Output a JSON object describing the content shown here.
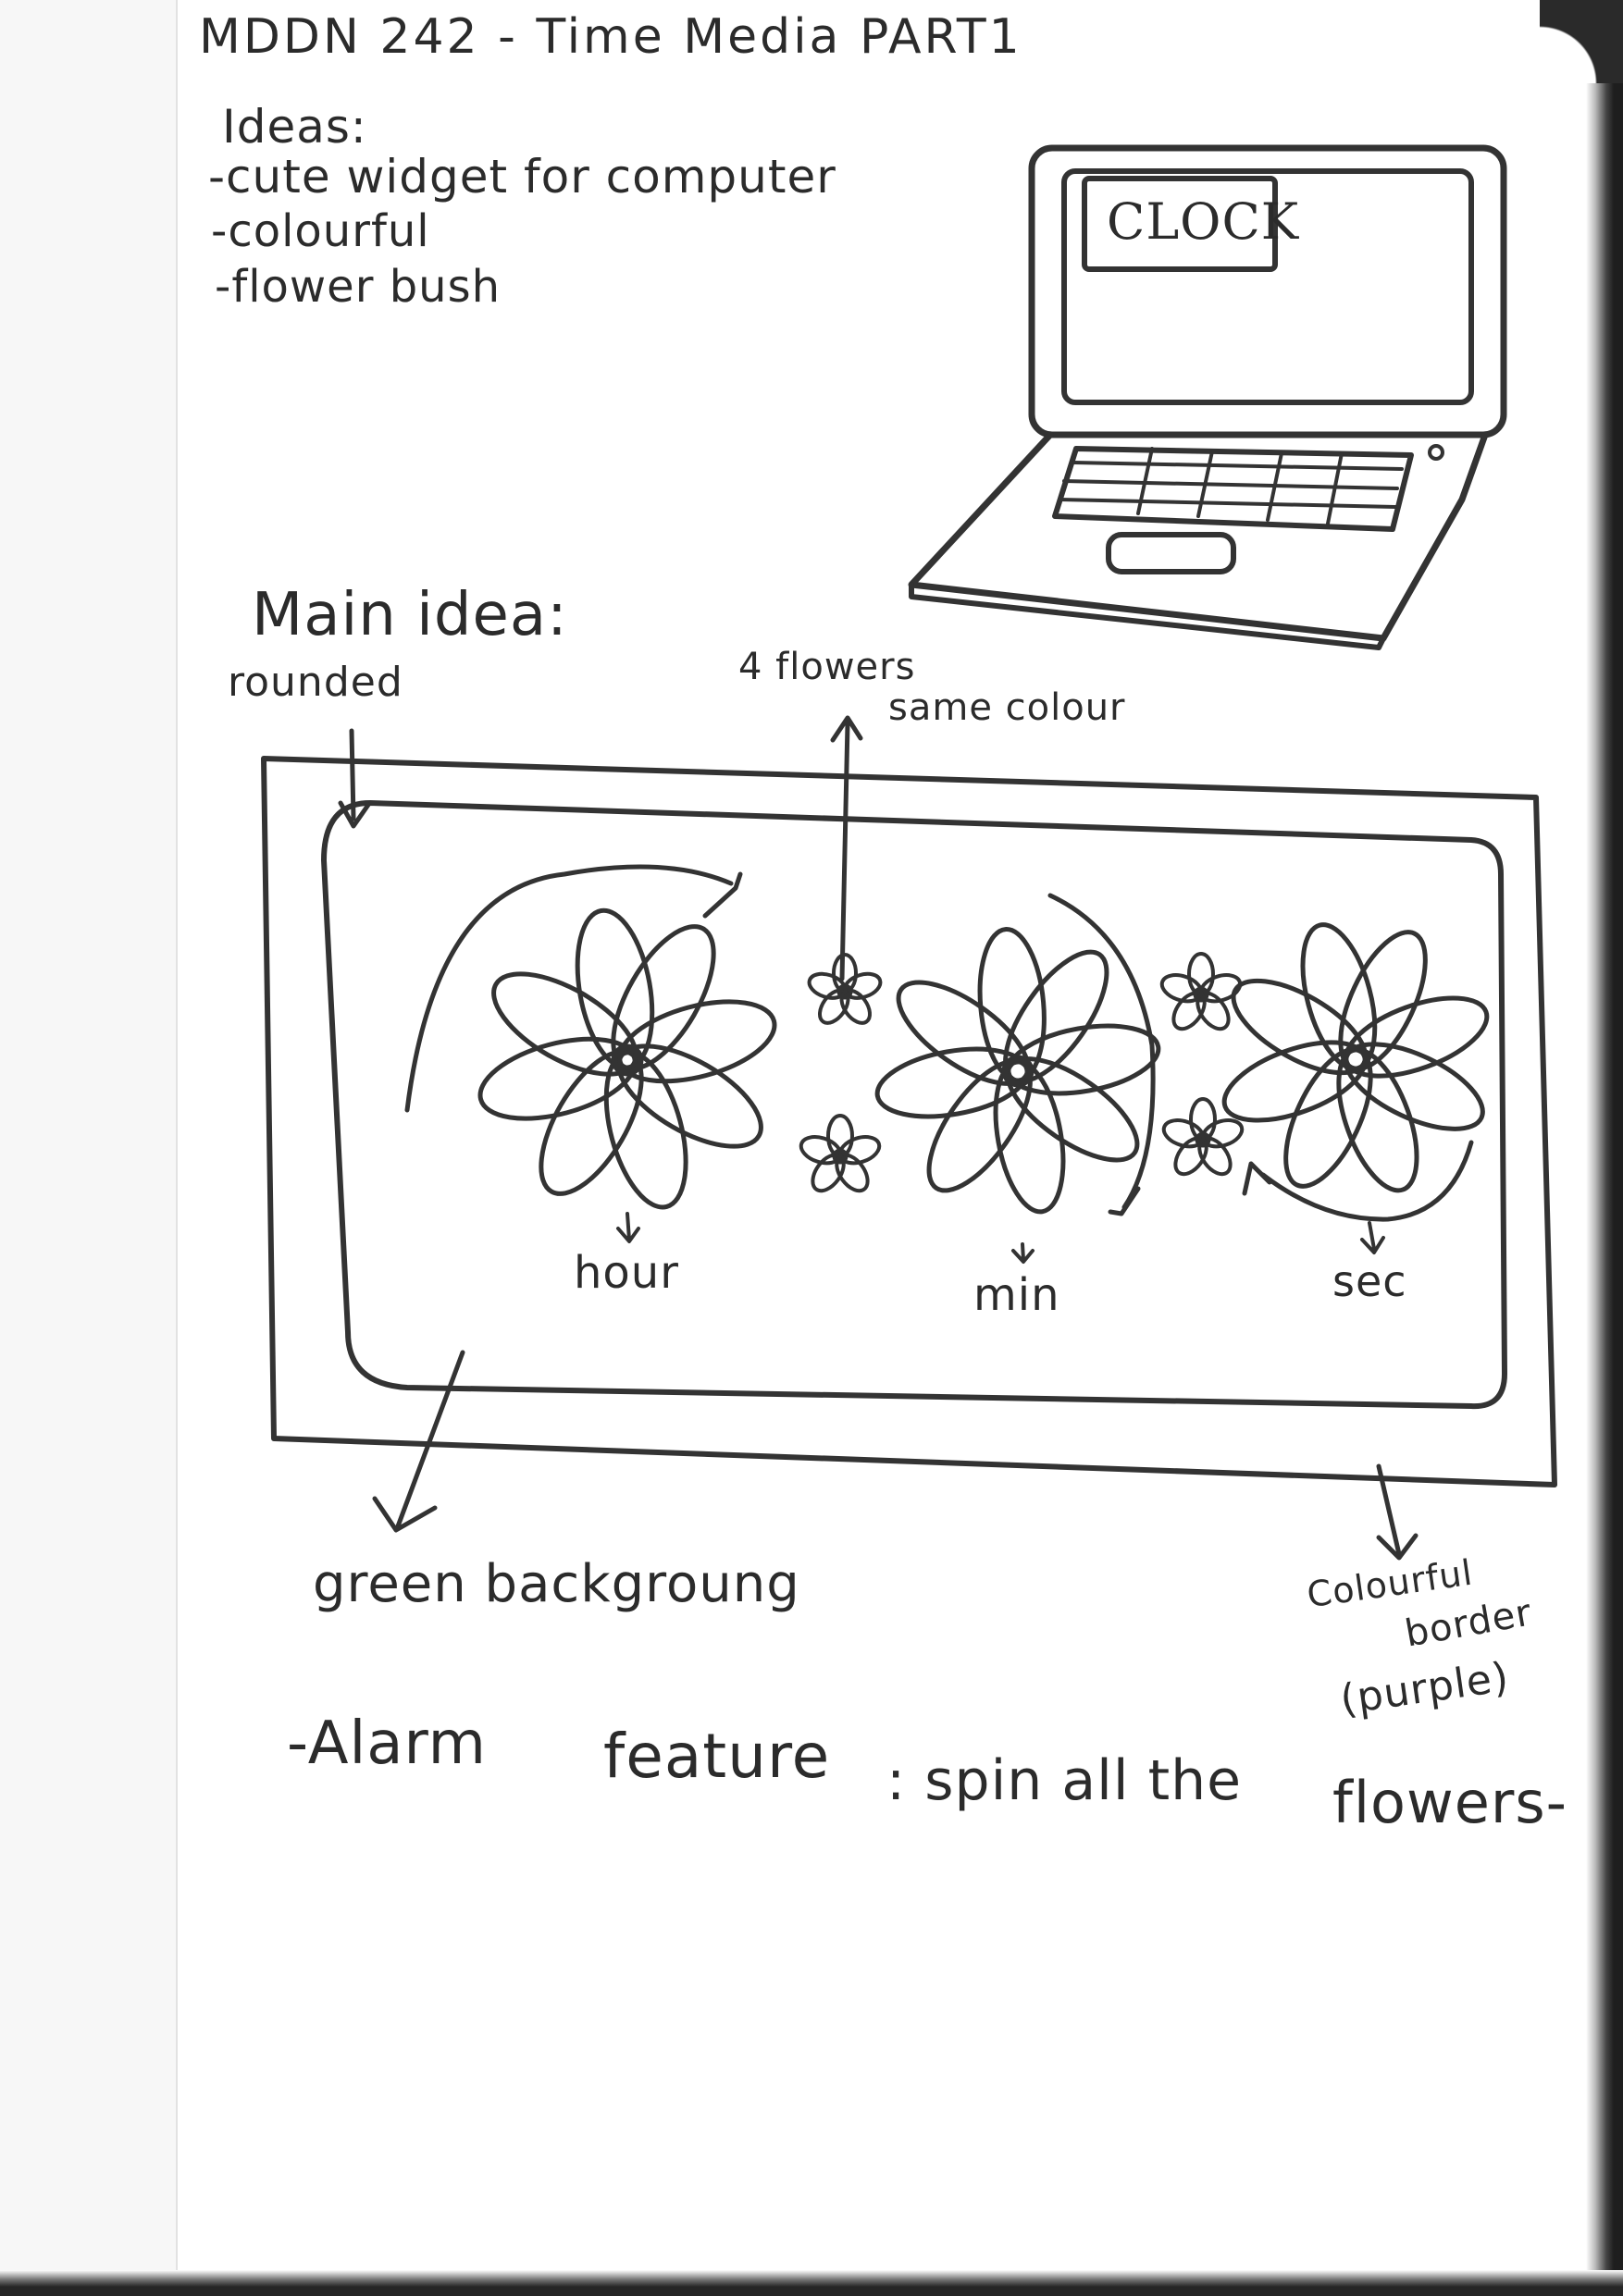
{
  "heading": {
    "title": "MDDN 242 - Time Media PART1"
  },
  "ideas": {
    "label": "Ideas:",
    "items": [
      "-cute widget for computer",
      "-colourful",
      "-flower bush"
    ]
  },
  "laptop": {
    "screen_label": "CLOCK"
  },
  "main_idea": {
    "label": "Main idea:",
    "rounded_note": "rounded",
    "flowers_note_line1": "4 flowers",
    "flowers_note_line2": "same colour",
    "hour_label": "hour",
    "min_label": "min",
    "sec_label": "sec",
    "background_note": "green backgroung",
    "border_note_line1": "Colourful",
    "border_note_line2": "border",
    "border_note_line3": "(purple)"
  },
  "alarm": {
    "text_part1": "-Alarm",
    "text_part2": "feature",
    "text_part3": ": spin all the",
    "text_part4": "flowers-"
  }
}
